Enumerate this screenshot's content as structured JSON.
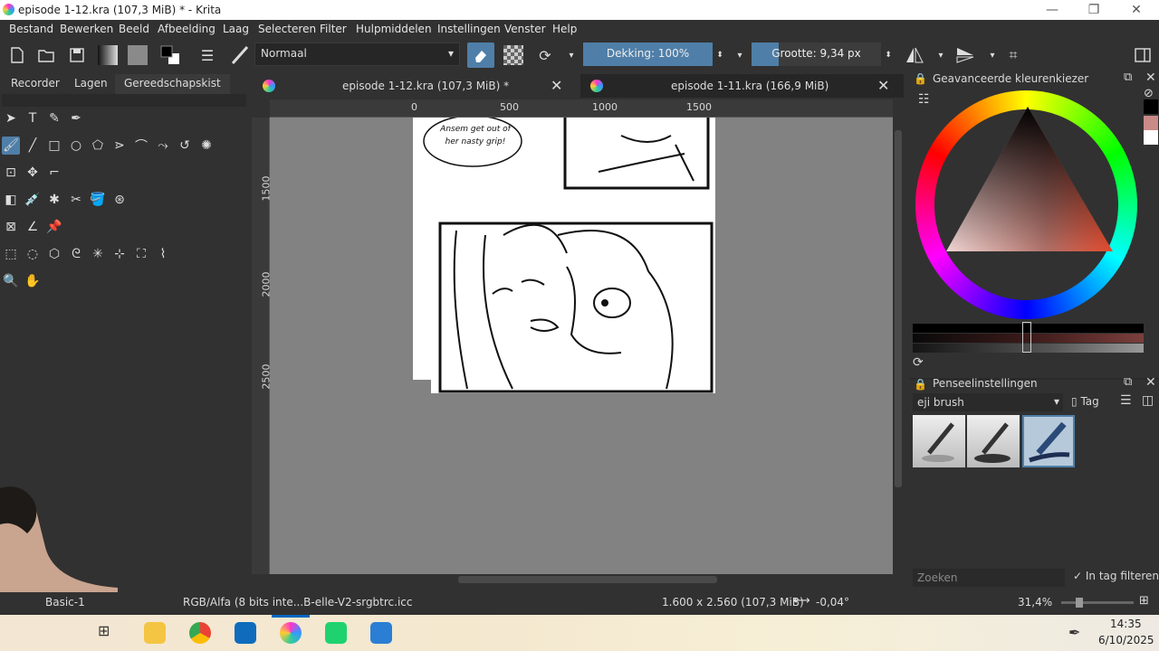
{
  "window": {
    "title": "episode 1-12.kra (107,3 MiB) * - Krita",
    "minimize": "—",
    "restore": "❐",
    "close": "✕"
  },
  "menu": [
    "Bestand",
    "Bewerken",
    "Beeld",
    "Afbeelding",
    "Laag",
    "Selecteren",
    "Filter",
    "Hulpmiddelen",
    "Instellingen",
    "Venster",
    "Help"
  ],
  "toolbar": {
    "blend_mode": "Normaal",
    "opacity": "Dekking: 100%",
    "size": "Grootte: 9,34 px"
  },
  "left_tabs": [
    "Recorder",
    "Lagen",
    "Gereedschapskist"
  ],
  "doc_tabs": [
    {
      "label": "episode 1-12.kra (107,3 MiB) *"
    },
    {
      "label": "episode 1-11.kra (166,9 MiB)"
    }
  ],
  "ruler": {
    "h_ticks": [
      "0",
      "500",
      "1000",
      "1500"
    ],
    "v_ticks": [
      "1500",
      "2000",
      "2500"
    ]
  },
  "canvas": {
    "speech_bubble": "Ansem get out of\nher nasty grip!"
  },
  "color_panel": {
    "title": "Geavanceerde kleurenkiezer"
  },
  "brush_panel": {
    "title": "Penseelinstellingen",
    "preset_tag": "eji brush",
    "tag_label": "Tag",
    "search_placeholder": "Zoeken",
    "filter_label": "In tag filteren"
  },
  "status": {
    "brush": "Basic-1",
    "color_profile": "RGB/Alfa (8 bits inte...B-elle-V2-srgbtrc.icc",
    "dimensions": "1.600 x 2.560 (107,3 MiB)",
    "rotation": "-0,04°",
    "zoom": "31,4%"
  },
  "clock": {
    "time": "14:35",
    "date": "6/10/2025"
  },
  "colors": {
    "accent": "#4f7fa8",
    "canvas_bg": "#828282",
    "panel_bg": "#313131"
  }
}
